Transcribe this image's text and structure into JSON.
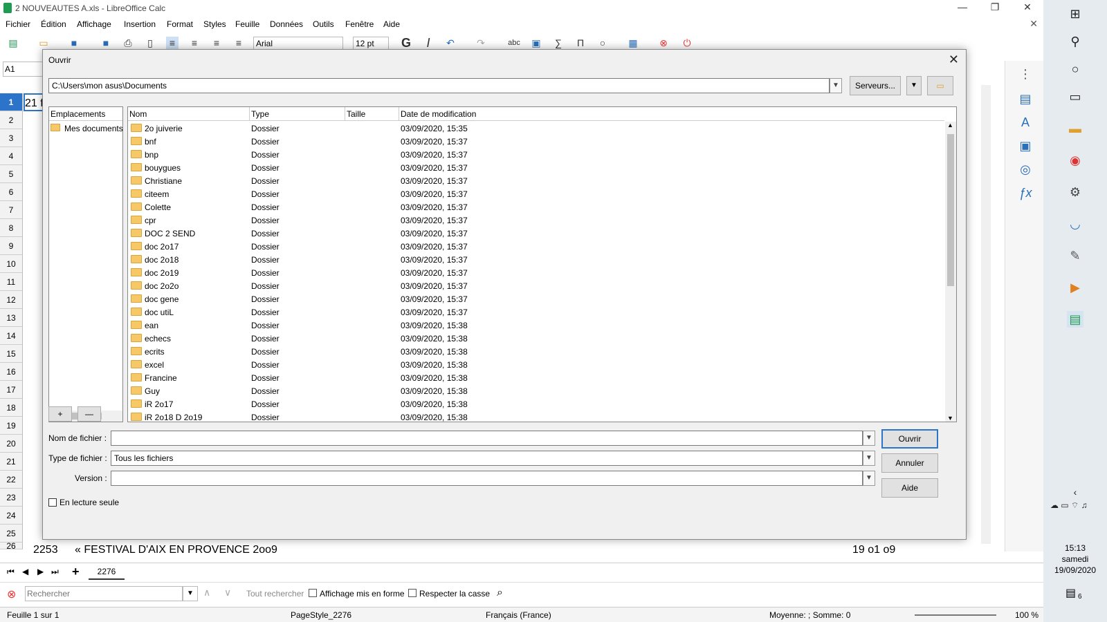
{
  "window": {
    "title": "2 NOUVEAUTES A.xls - LibreOffice Calc",
    "minimize": "—",
    "maximize": "❐",
    "close": "✕"
  },
  "menu": [
    "Fichier",
    "Édition",
    "Affichage",
    "Insertion",
    "Format",
    "Styles",
    "Feuille",
    "Données",
    "Outils",
    "Fenêtre",
    "Aide"
  ],
  "toolbar": {
    "font_name": "Arial",
    "font_size": "12 pt",
    "bold": "G",
    "italic": "I",
    "spell": "abc"
  },
  "namebox": "A1",
  "sheet": {
    "rows": [
      "1",
      "2",
      "3",
      "4",
      "5",
      "6",
      "7",
      "8",
      "9",
      "10",
      "11",
      "12",
      "13",
      "14",
      "15",
      "16",
      "17",
      "18",
      "19",
      "20",
      "21",
      "22",
      "23",
      "24",
      "25",
      "26"
    ],
    "cell_a1": "21 f",
    "cell_col_a_partial": "2",
    "row26_a": "2253",
    "row26_b": "«  FESTIVAL D'AIX EN PROVENCE 2oo9",
    "row26_c": "19 o1 o9"
  },
  "tabs": {
    "sheet_name": "2276",
    "add": "+"
  },
  "findbar": {
    "placeholder": "Rechercher",
    "find_all": "Tout rechercher",
    "formatted": "Affichage mis en forme",
    "match_case": "Respecter la casse"
  },
  "status": {
    "sheet": "Feuille 1 sur 1",
    "pagestyle": "PageStyle_2276",
    "language": "Français (France)",
    "sum": "Moyenne: ; Somme: 0",
    "zoom": "100 %"
  },
  "dialog": {
    "title": "Ouvrir",
    "path": "C:\\Users\\mon asus\\Documents",
    "servers_button": "Serveurs...",
    "places_header": "Emplacements",
    "places": [
      "Mes documents"
    ],
    "add_place": "+",
    "remove_place": "—",
    "columns": {
      "name": "Nom",
      "type": "Type",
      "size": "Taille",
      "date": "Date de modification"
    },
    "files": [
      {
        "name": "2o juiverie",
        "type": "Dossier",
        "date": "03/09/2020, 15:35"
      },
      {
        "name": "bnf",
        "type": "Dossier",
        "date": "03/09/2020, 15:37"
      },
      {
        "name": "bnp",
        "type": "Dossier",
        "date": "03/09/2020, 15:37"
      },
      {
        "name": "bouygues",
        "type": "Dossier",
        "date": "03/09/2020, 15:37"
      },
      {
        "name": "Christiane",
        "type": "Dossier",
        "date": "03/09/2020, 15:37"
      },
      {
        "name": "citeem",
        "type": "Dossier",
        "date": "03/09/2020, 15:37"
      },
      {
        "name": "Colette",
        "type": "Dossier",
        "date": "03/09/2020, 15:37"
      },
      {
        "name": "cpr",
        "type": "Dossier",
        "date": "03/09/2020, 15:37"
      },
      {
        "name": "DOC 2 SEND",
        "type": "Dossier",
        "date": "03/09/2020, 15:37"
      },
      {
        "name": "doc 2o17",
        "type": "Dossier",
        "date": "03/09/2020, 15:37"
      },
      {
        "name": "doc 2o18",
        "type": "Dossier",
        "date": "03/09/2020, 15:37"
      },
      {
        "name": "doc 2o19",
        "type": "Dossier",
        "date": "03/09/2020, 15:37"
      },
      {
        "name": "doc 2o2o",
        "type": "Dossier",
        "date": "03/09/2020, 15:37"
      },
      {
        "name": "doc gene",
        "type": "Dossier",
        "date": "03/09/2020, 15:37"
      },
      {
        "name": "doc utiL",
        "type": "Dossier",
        "date": "03/09/2020, 15:37"
      },
      {
        "name": "ean",
        "type": "Dossier",
        "date": "03/09/2020, 15:38"
      },
      {
        "name": "echecs",
        "type": "Dossier",
        "date": "03/09/2020, 15:38"
      },
      {
        "name": "ecrits",
        "type": "Dossier",
        "date": "03/09/2020, 15:38"
      },
      {
        "name": "excel",
        "type": "Dossier",
        "date": "03/09/2020, 15:38"
      },
      {
        "name": "Francine",
        "type": "Dossier",
        "date": "03/09/2020, 15:38"
      },
      {
        "name": "Guy",
        "type": "Dossier",
        "date": "03/09/2020, 15:38"
      },
      {
        "name": "iR 2o17",
        "type": "Dossier",
        "date": "03/09/2020, 15:38"
      },
      {
        "name": "iR 2o18 D 2o19",
        "type": "Dossier",
        "date": "03/09/2020, 15:38"
      }
    ],
    "filename_label": "Nom de fichier :",
    "filename_value": "",
    "filetype_label": "Type de fichier :",
    "filetype_value": "Tous les fichiers",
    "version_label": "Version :",
    "version_value": "",
    "readonly_label": "En lecture seule",
    "open_button": "Ouvrir",
    "cancel_button": "Annuler",
    "help_button": "Aide"
  },
  "taskbar": {
    "time": "15:13",
    "day": "samedi",
    "date": "19/09/2020",
    "notifications": "6"
  },
  "colors": {
    "accent": "#2c74c9",
    "folder": "#f6c868",
    "calc_green": "#1e9c52"
  }
}
